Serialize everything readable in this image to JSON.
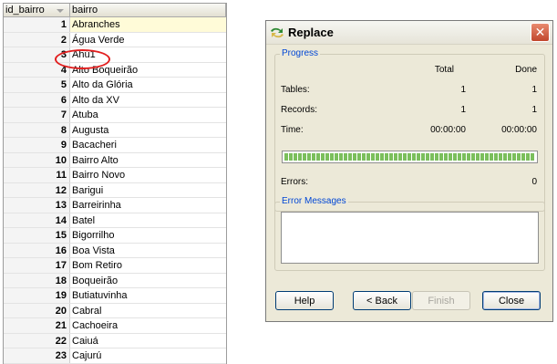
{
  "grid": {
    "columns": [
      "id_bairro",
      "bairro"
    ],
    "rows": [
      {
        "id": "1",
        "name": "Abranches"
      },
      {
        "id": "2",
        "name": "Água Verde"
      },
      {
        "id": "3",
        "name": "Ahú1"
      },
      {
        "id": "4",
        "name": "Alto Boqueirão"
      },
      {
        "id": "5",
        "name": "Alto da Glória"
      },
      {
        "id": "6",
        "name": "Alto da XV"
      },
      {
        "id": "7",
        "name": "Atuba"
      },
      {
        "id": "8",
        "name": "Augusta"
      },
      {
        "id": "9",
        "name": "Bacacheri"
      },
      {
        "id": "10",
        "name": "Bairro Alto"
      },
      {
        "id": "11",
        "name": "Bairro Novo"
      },
      {
        "id": "12",
        "name": "Barigui"
      },
      {
        "id": "13",
        "name": "Barreirinha"
      },
      {
        "id": "14",
        "name": "Batel"
      },
      {
        "id": "15",
        "name": "Bigorrilho"
      },
      {
        "id": "16",
        "name": "Boa Vista"
      },
      {
        "id": "17",
        "name": "Bom Retiro"
      },
      {
        "id": "18",
        "name": "Boqueirão"
      },
      {
        "id": "19",
        "name": "Butiatuvinha"
      },
      {
        "id": "20",
        "name": "Cabral"
      },
      {
        "id": "21",
        "name": "Cachoeira"
      },
      {
        "id": "22",
        "name": "Caiuá"
      },
      {
        "id": "23",
        "name": "Cajurú"
      }
    ],
    "highlight_color": "#e21f1f"
  },
  "dialog": {
    "title": "Replace",
    "title_icon": "replace-arrows-icon",
    "close_icon": "close-x-icon",
    "progress": {
      "legend": "Progress",
      "col_total": "Total",
      "col_done": "Done",
      "tables_label": "Tables:",
      "tables_total": "1",
      "tables_done": "1",
      "records_label": "Records:",
      "records_total": "1",
      "records_done": "1",
      "time_label": "Time:",
      "time_total": "00:00:00",
      "time_done": "00:00:00",
      "bar_fraction": 1.0,
      "bar_color": "#7bbf5c",
      "errors_label": "Errors:",
      "errors_value": "0"
    },
    "error_messages": {
      "legend": "Error Messages"
    },
    "buttons": {
      "help": "Help",
      "back": "< Back",
      "finish": "Finish",
      "close": "Close"
    }
  }
}
